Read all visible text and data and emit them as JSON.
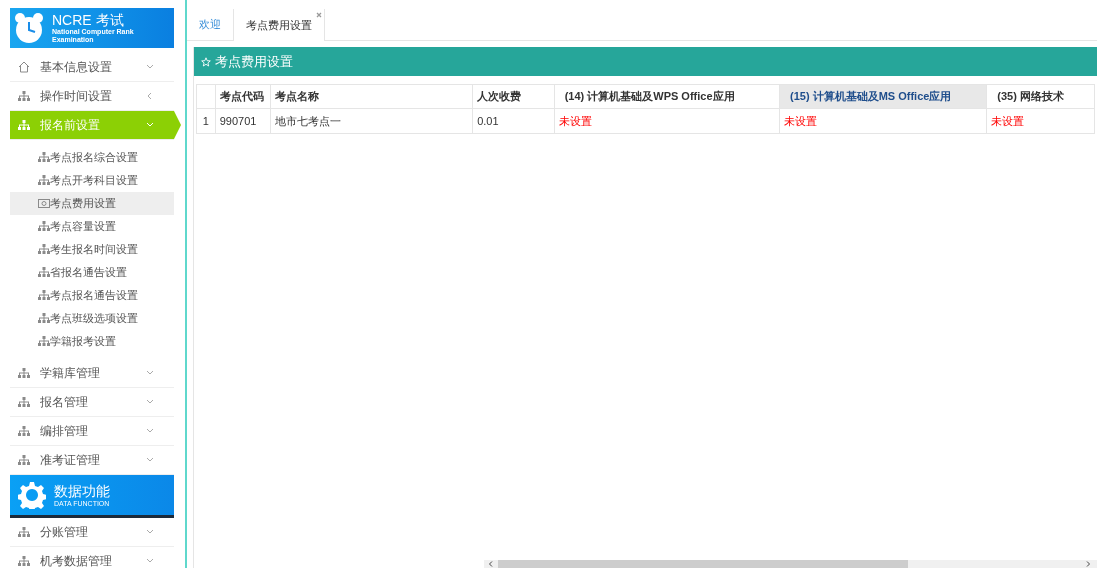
{
  "sidebar": {
    "logo": {
      "title": "NCRE 考试",
      "subtitle": "National Computer Rank Examination"
    },
    "groups": [
      {
        "label": "基本信息设置",
        "kind": "home",
        "selected": false
      },
      {
        "label": "操作时间设置",
        "kind": "sitemap",
        "selected": false
      },
      {
        "label": "报名前设置",
        "kind": "sitemap",
        "selected": true,
        "children": [
          {
            "label": "考点报名综合设置",
            "kind": "sitemap",
            "selected": false
          },
          {
            "label": "考点开考科目设置",
            "kind": "sitemap",
            "selected": false
          },
          {
            "label": "考点费用设置",
            "kind": "money",
            "selected": true
          },
          {
            "label": "考点容量设置",
            "kind": "sitemap",
            "selected": false
          },
          {
            "label": "考生报名时间设置",
            "kind": "sitemap",
            "selected": false
          },
          {
            "label": "省报名通告设置",
            "kind": "sitemap",
            "selected": false
          },
          {
            "label": "考点报名通告设置",
            "kind": "sitemap",
            "selected": false
          },
          {
            "label": "考点班级选项设置",
            "kind": "sitemap",
            "selected": false
          },
          {
            "label": "学籍报考设置",
            "kind": "sitemap",
            "selected": false
          }
        ]
      },
      {
        "label": "学籍库管理",
        "kind": "sitemap",
        "selected": false
      },
      {
        "label": "报名管理",
        "kind": "sitemap",
        "selected": false
      },
      {
        "label": "编排管理",
        "kind": "sitemap",
        "selected": false
      },
      {
        "label": "准考证管理",
        "kind": "sitemap",
        "selected": false
      }
    ],
    "banner": {
      "title": "数据功能",
      "subtitle": "DATA FUNCTION"
    },
    "groups_2": [
      {
        "label": "分账管理",
        "kind": "sitemap",
        "selected": false
      },
      {
        "label": "机考数据管理",
        "kind": "sitemap",
        "selected": false
      }
    ]
  },
  "tabs": [
    {
      "label": "欢迎",
      "selected": false
    },
    {
      "label": "考点费用设置",
      "selected": true
    }
  ],
  "panel": {
    "title": "考点费用设置",
    "table": {
      "columns": [
        {
          "selected": false
        },
        {
          "label": "考点代码",
          "selected": false
        },
        {
          "label": "考点名称",
          "selected": false
        },
        {
          "label": "人次收费",
          "selected": false
        },
        {
          "label": "(14) 计算机基础及WPS Office应用",
          "selected": false
        },
        {
          "label": "(15) 计算机基础及MS Office应用",
          "selected": true
        },
        {
          "label": "(35) 网络技术",
          "selected": false
        }
      ],
      "rows": [
        {
          "cells": [
            {
              "text": "1",
              "kind": "plain"
            },
            {
              "text": "990701",
              "kind": "plain"
            },
            {
              "text": "地市七考点一",
              "kind": "plain"
            },
            {
              "text": "0.01",
              "kind": "plain"
            },
            {
              "text": "未设置",
              "kind": "warning"
            },
            {
              "text": "未设置",
              "kind": "warning"
            },
            {
              "text": "未设置",
              "kind": "warning"
            }
          ]
        }
      ]
    }
  }
}
